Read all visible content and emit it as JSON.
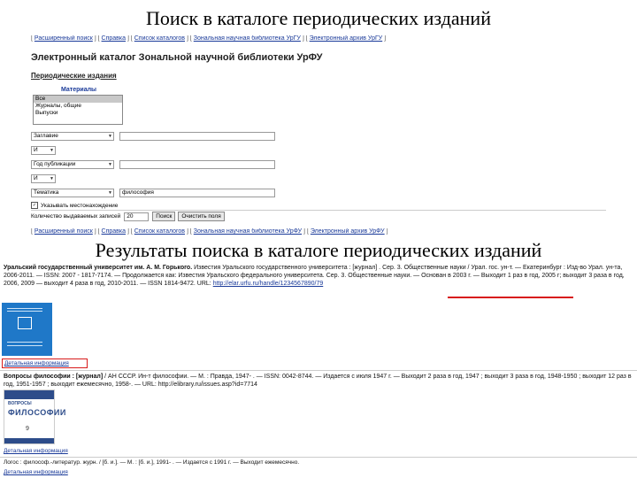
{
  "titles": {
    "top": "Поиск в каталоге периодических изданий",
    "middle": "Результаты поиска в каталоге периодических изданий"
  },
  "nav": {
    "items": [
      "Расширенный поиск",
      "Справка",
      "Список каталогов",
      "Зональная научная библиотека УрГУ",
      "Электронный архив УрГУ"
    ]
  },
  "nav_bottom": {
    "items": [
      "Расширенный поиск",
      "Справка",
      "Список каталогов",
      "Зональная научная библиотека УрФУ",
      "Электронный архив УрФУ"
    ]
  },
  "catalog_title": "Электронный каталог Зональной научной библиотеки УрФУ",
  "section_title": "Периодические издания",
  "materials": {
    "label": "Материалы",
    "options": [
      "Все",
      "Журналы, общие",
      "Выпуски"
    ]
  },
  "search_rows": [
    {
      "field": "Заглавие",
      "value": ""
    },
    {
      "field": "И",
      "value": null
    },
    {
      "field": "Год публикации",
      "value": ""
    },
    {
      "field": "И",
      "value": null
    },
    {
      "field": "Тематика",
      "value": "философия"
    }
  ],
  "options": {
    "checkbox_label": "Указывать местонахождение",
    "count_label": "Количество выдаваемых записей",
    "count_value": "20",
    "search_button": "Поиск",
    "clear_button": "Очистить поля"
  },
  "results": [
    {
      "title": "Уральский государственный университет им. А. М. Горького.",
      "text": "Известия Уральского государственного университета : [журнал] . Сер. 3. Общественные науки / Урал. гос. ун-т. — Екатеринбург : Изд-во Урал. ун-та, 2006-2011. — ISSN: 2007 - 1817-7174. — Продолжается как: Известия Уральского федерального университета. Сер. 3. Общественные науки. — Основан в 2003 г. — Выходит 1 раз в год, 2005 г; выходит 3 раза в год, 2006, 2009 — выходит 4 раза в год, 2010-2011. — ISSN 1814-9472. URL:",
      "url": "http://elar.urfu.ru/handle/1234567890/79",
      "link": "Детальная информация"
    },
    {
      "title": "Вопросы философии : [журнал]",
      "text": "/ АН СССР. Ин-т философии. — М. : Правда, 1947- . — ISSN: 0042-8744. — Издается с июля 1947 г. — Выходит 2 раза в год, 1947 ; выходит 3 раза в год, 1948-1950 ; выходит 12 раз в год, 1951-1957 ; выходит ежемесячно, 1958-. — URL: http://elibrary.ru/issues.asp?id=7714",
      "cover_sub": "ВОПРОСЫ",
      "cover_main": "ФИЛОСОФИИ",
      "cover_num": "9",
      "link": "Детальная информация"
    },
    {
      "title": "",
      "text": "Логос : философ.-литератур. журн. / [б. и.]. — М. : [б. и.], 1991- . — Издается с 1991 г. — Выходит ежемесячно.",
      "link": "Детальная информация"
    }
  ]
}
